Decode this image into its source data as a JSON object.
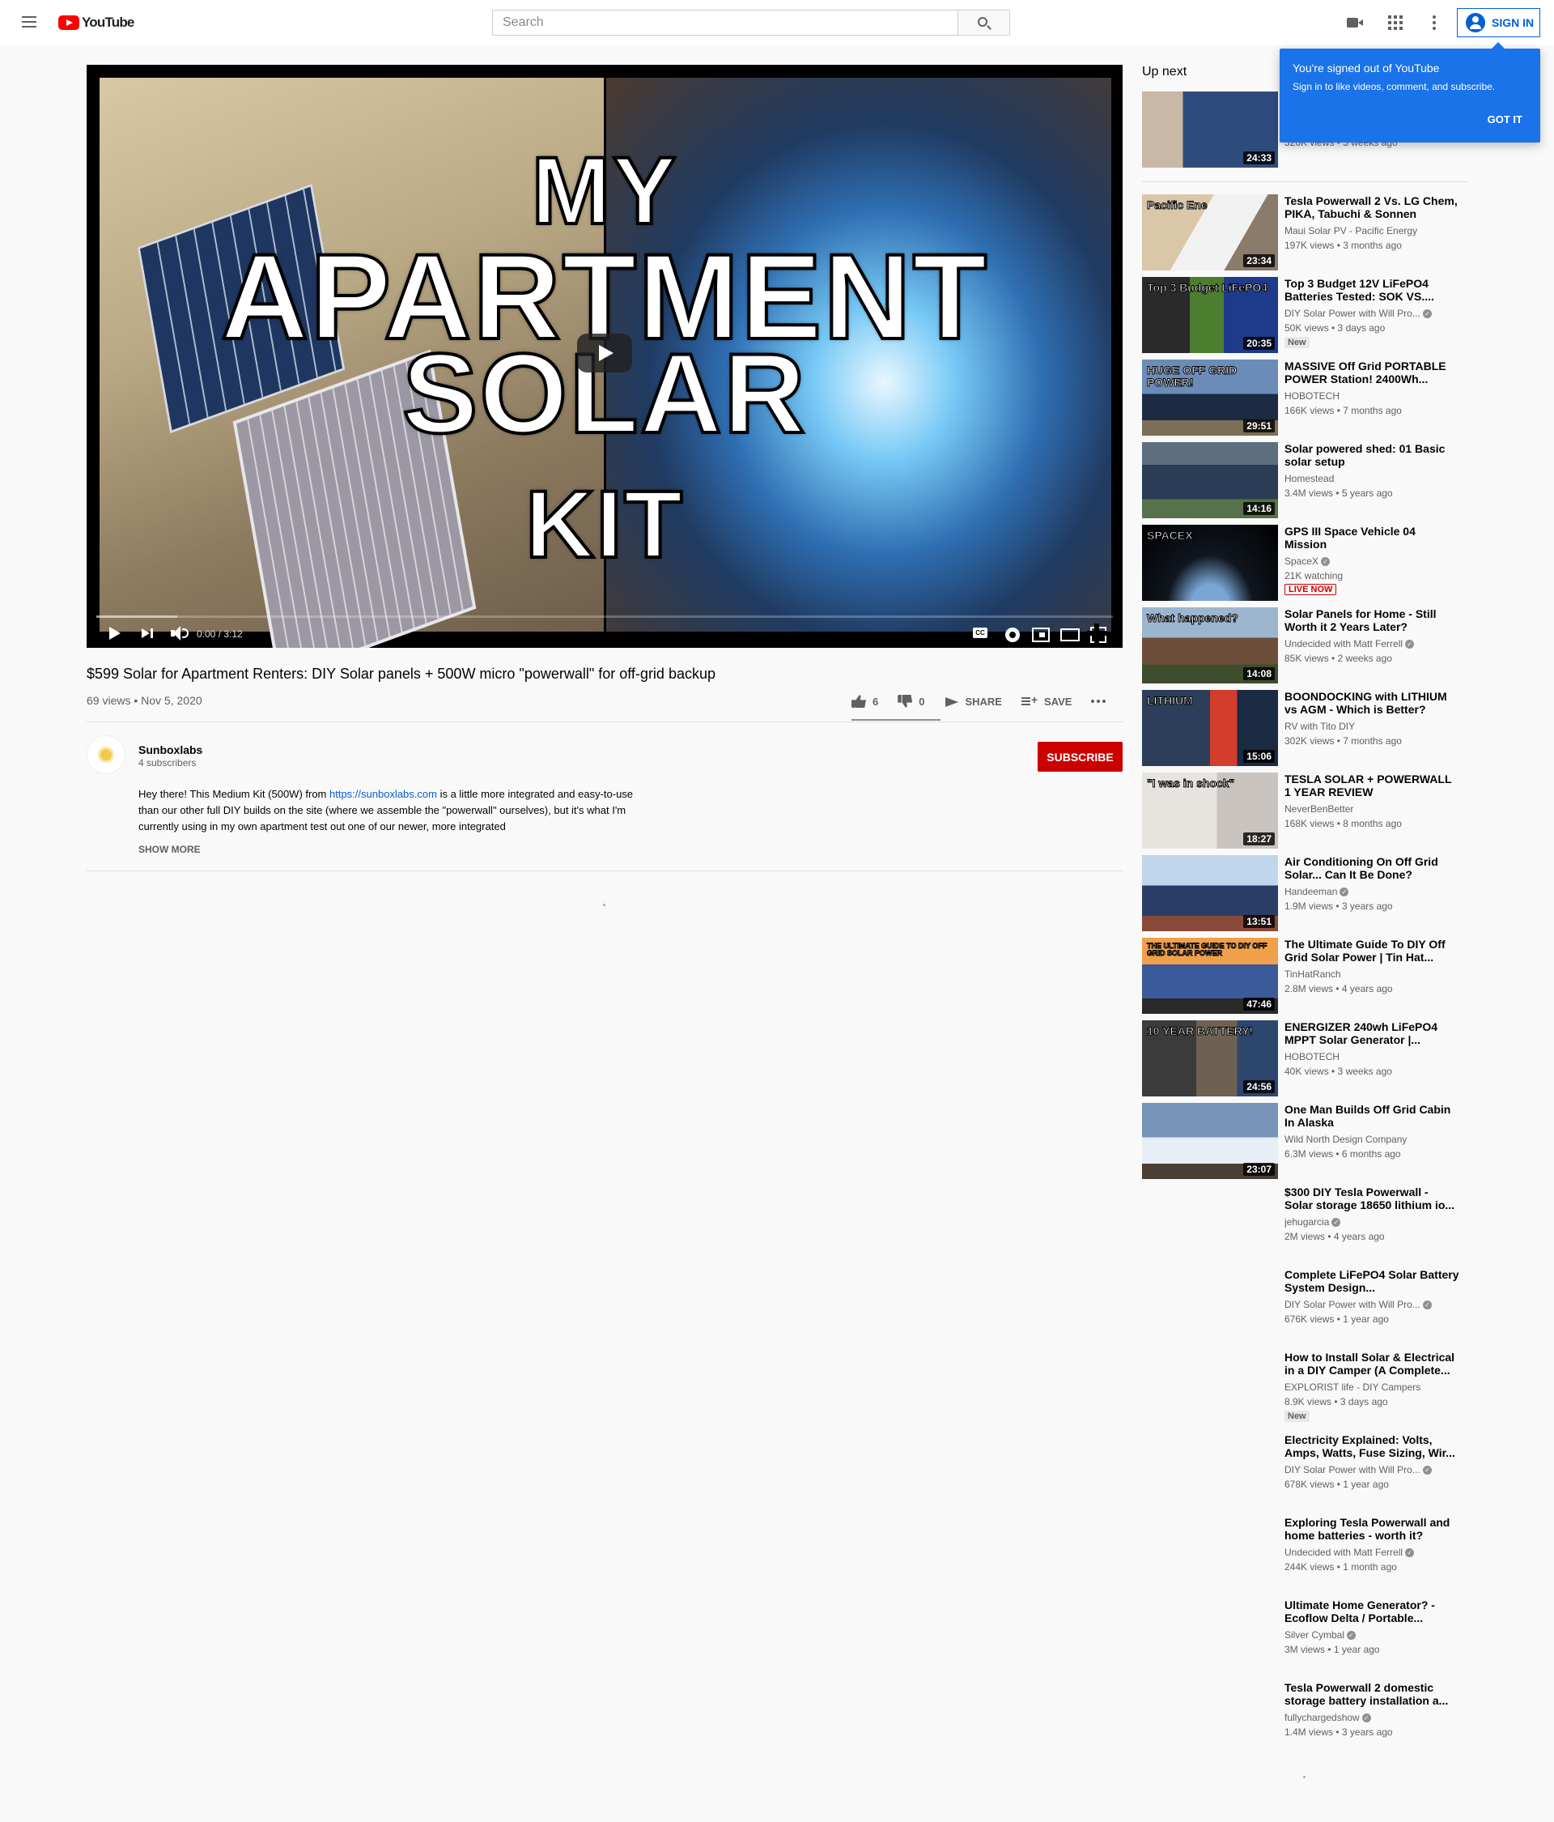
{
  "masthead": {
    "logo_text": "YouTube",
    "search_placeholder": "Search",
    "sign_in_label": "SIGN IN"
  },
  "player": {
    "thumbnail_words": [
      "MY",
      "APARTMENT",
      "SOLAR",
      "KIT"
    ],
    "time_current": "0:00",
    "time_total": "3:12",
    "time_display": "0:00 / 3:12",
    "progress_buffered": 0.08
  },
  "video": {
    "title": "$599 Solar for Apartment Renters: DIY Solar panels + 500W micro \"powerwall\" for off-grid backup",
    "views": "69 views",
    "date": "Nov 5, 2020",
    "meta_line": "69 views • Nov 5, 2020",
    "likes": "6",
    "dislikes": "0",
    "share_label": "SHARE",
    "save_label": "SAVE"
  },
  "owner": {
    "channel_name": "Sunboxlabs",
    "subscribers": "4 subscribers",
    "subscribe_label": "SUBSCRIBE"
  },
  "description": {
    "text_before_link": "Hey there! This Medium Kit (500W) from ",
    "link": "https://sunboxlabs.com",
    "text_after_link": " is a little more integrated and easy-to-use than our other full DIY builds on the site (where we assemble the \"powerwall\" ourselves), but it's what I'm currently using in my own apartment test out one of our newer, more integrated",
    "show_more_label": "SHOW MORE"
  },
  "popup": {
    "title": "You're signed out of YouTube",
    "text": "Sign in to like videos, comment, and subscribe.",
    "button": "GOT IT"
  },
  "sidebar": {
    "up_next_label": "Up next",
    "first_item": {
      "views": "320K views • 3 weeks ago",
      "duration": "24:33"
    },
    "items": [
      {
        "title": "Tesla Powerwall 2 Vs. LG Chem, PIKA, Tabuchi & Sonnen",
        "channel": "Maui Solar PV - Pacific Energy",
        "verified": false,
        "views": "197K views • 3 months ago",
        "duration": "23:34",
        "badge": "",
        "thumb_text": "Pacific Ene"
      },
      {
        "title": "Top 3 Budget 12V LiFePO4 Batteries Tested: SOK VS....",
        "channel": "DIY Solar Power with Will Pro...",
        "verified": true,
        "views": "50K views • 3 days ago",
        "duration": "20:35",
        "badge": "New",
        "thumb_text": "Top 3 Budget LiFePO4"
      },
      {
        "title": "MASSIVE Off Grid PORTABLE POWER Station! 2400Wh...",
        "channel": "HOBOTECH",
        "verified": false,
        "views": "166K views • 7 months ago",
        "duration": "29:51",
        "badge": "",
        "thumb_text": "HUGE OFF GRID POWER!"
      },
      {
        "title": "Solar powered shed: 01 Basic solar setup",
        "channel": "Homestead",
        "verified": false,
        "views": "3.4M views • 5 years ago",
        "duration": "14:16",
        "badge": "",
        "thumb_text": ""
      },
      {
        "title": "GPS III Space Vehicle 04 Mission",
        "channel": "SpaceX",
        "verified": true,
        "views": "21K watching",
        "duration": "",
        "badge": "LIVE NOW",
        "thumb_text": "SPACEX"
      },
      {
        "title": "Solar Panels for Home - Still Worth it 2 Years Later?",
        "channel": "Undecided with Matt Ferrell",
        "verified": true,
        "views": "85K views • 2 weeks ago",
        "duration": "14:08",
        "badge": "",
        "thumb_text": "What happened?"
      },
      {
        "title": "BOONDOCKING with LITHIUM vs AGM - Which is Better?",
        "channel": "RV with Tito DIY",
        "verified": false,
        "views": "302K views • 7 months ago",
        "duration": "15:06",
        "badge": "",
        "thumb_text": "LITHIUM"
      },
      {
        "title": "TESLA SOLAR + POWERWALL 1 YEAR REVIEW",
        "channel": "NeverBenBetter",
        "verified": false,
        "views": "168K views • 8 months ago",
        "duration": "18:27",
        "badge": "",
        "thumb_text": "\"I was in shock\""
      },
      {
        "title": "Air Conditioning On Off Grid Solar... Can It Be Done?",
        "channel": "Handeeman",
        "verified": true,
        "views": "1.9M views • 3 years ago",
        "duration": "13:51",
        "badge": "",
        "thumb_text": ""
      },
      {
        "title": "The Ultimate Guide To DIY Off Grid Solar Power | Tin Hat...",
        "channel": "TinHatRanch",
        "verified": false,
        "views": "2.8M views • 4 years ago",
        "duration": "47:46",
        "badge": "",
        "thumb_text": "THE ULTIMATE GUIDE TO DIY OFF GRID SOLAR POWER"
      },
      {
        "title": "ENERGIZER 240wh LiFePO4 MPPT Solar Generator |...",
        "channel": "HOBOTECH",
        "verified": false,
        "views": "40K views • 3 weeks ago",
        "duration": "24:56",
        "badge": "",
        "thumb_text": "10 YEAR BATTERY!"
      },
      {
        "title": "One Man Builds Off Grid Cabin In Alaska",
        "channel": "Wild North Design Company",
        "verified": false,
        "views": "6.3M views • 6 months ago",
        "duration": "23:07",
        "badge": "",
        "thumb_text": ""
      },
      {
        "title": "$300 DIY Tesla Powerwall - Solar storage 18650 lithium io...",
        "channel": "jehugarcia",
        "verified": true,
        "views": "2M views • 4 years ago",
        "duration": "",
        "badge": "",
        "thumb_text": ""
      },
      {
        "title": "Complete LiFePO4 Solar Battery System Design...",
        "channel": "DIY Solar Power with Will Pro...",
        "verified": true,
        "views": "676K views • 1 year ago",
        "duration": "",
        "badge": "",
        "thumb_text": ""
      },
      {
        "title": "How to Install Solar & Electrical in a DIY Camper (A Complete...",
        "channel": "EXPLORIST life - DIY Campers",
        "verified": false,
        "views": "8.9K views • 3 days ago",
        "duration": "",
        "badge": "New",
        "thumb_text": ""
      },
      {
        "title": "Electricity Explained: Volts, Amps, Watts, Fuse Sizing, Wir...",
        "channel": "DIY Solar Power with Will Pro...",
        "verified": true,
        "views": "678K views • 1 year ago",
        "duration": "",
        "badge": "",
        "thumb_text": ""
      },
      {
        "title": "Exploring Tesla Powerwall and home batteries - worth it?",
        "channel": "Undecided with Matt Ferrell",
        "verified": true,
        "views": "244K views • 1 month ago",
        "duration": "",
        "badge": "",
        "thumb_text": ""
      },
      {
        "title": "Ultimate Home Generator? - Ecoflow Delta / Portable...",
        "channel": "Silver Cymbal",
        "verified": true,
        "views": "3M views • 1 year ago",
        "duration": "",
        "badge": "",
        "thumb_text": ""
      },
      {
        "title": "Tesla Powerwall 2 domestic storage battery installation a...",
        "channel": "fullychargedshow",
        "verified": true,
        "views": "1.4M views • 3 years ago",
        "duration": "",
        "badge": "",
        "thumb_text": ""
      }
    ]
  }
}
